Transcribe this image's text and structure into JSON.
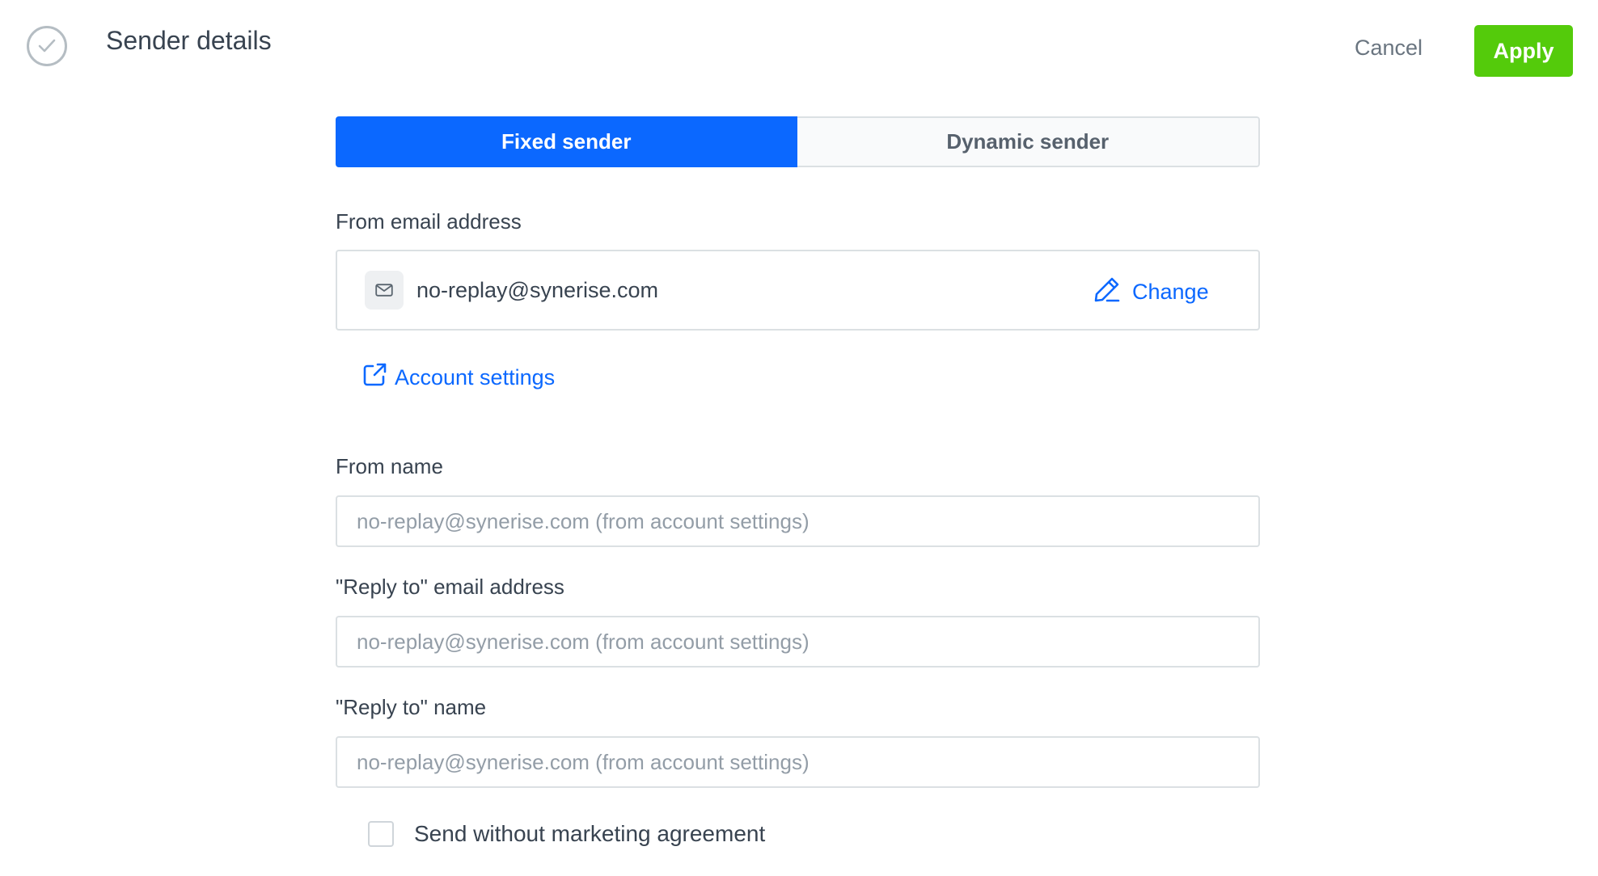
{
  "header": {
    "title": "Sender details",
    "cancel_label": "Cancel",
    "apply_label": "Apply"
  },
  "tabs": [
    {
      "label": "Fixed sender",
      "active": true
    },
    {
      "label": "Dynamic sender",
      "active": false
    }
  ],
  "from_email": {
    "label": "From email address",
    "value": "no-replay@synerise.com",
    "change_label": "Change",
    "account_settings_label": "Account settings"
  },
  "from_name": {
    "label": "From name",
    "placeholder": "no-replay@synerise.com (from account settings)"
  },
  "reply_to_email": {
    "label": "\"Reply to\" email address",
    "placeholder": "no-replay@synerise.com (from account settings)"
  },
  "reply_to_name": {
    "label": "\"Reply to\" name",
    "placeholder": "no-replay@synerise.com (from account settings)"
  },
  "marketing": {
    "label": "Send without marketing agreement",
    "checked": false
  },
  "colors": {
    "accent": "#0b68ff",
    "apply": "#54cb0b",
    "text": "#384350",
    "muted": "#939da7",
    "border": "#dbe0e3"
  },
  "icons": [
    "check-circle-icon",
    "mail-icon",
    "pencil-icon",
    "external-link-icon"
  ]
}
